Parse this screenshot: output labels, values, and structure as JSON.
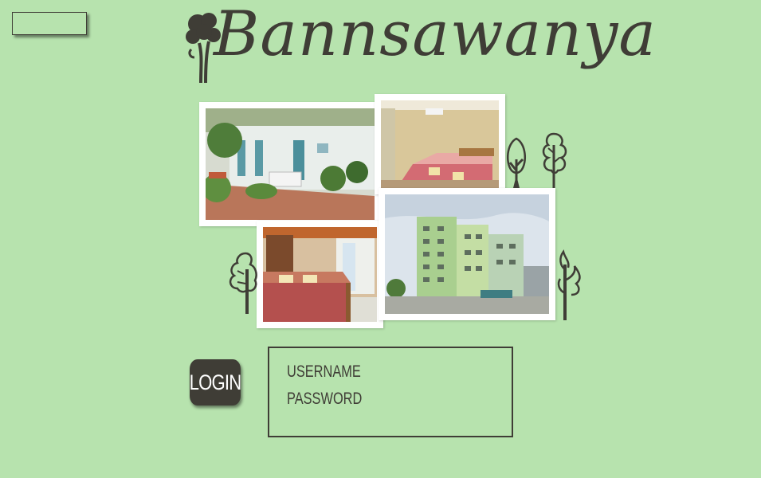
{
  "site": {
    "title": "Bannsawanya"
  },
  "photos": [
    {
      "name": "guesthouse-exterior-photo"
    },
    {
      "name": "bedroom-photo-1"
    },
    {
      "name": "bedroom-photo-2"
    },
    {
      "name": "building-photo"
    }
  ],
  "login": {
    "button_label": "LOGIN",
    "username_label": "USERNAME",
    "password_label": "PASSWORD"
  },
  "colors": {
    "background": "#b7e3ae",
    "ink": "#3f3d36",
    "photo_border": "#ffffff"
  }
}
